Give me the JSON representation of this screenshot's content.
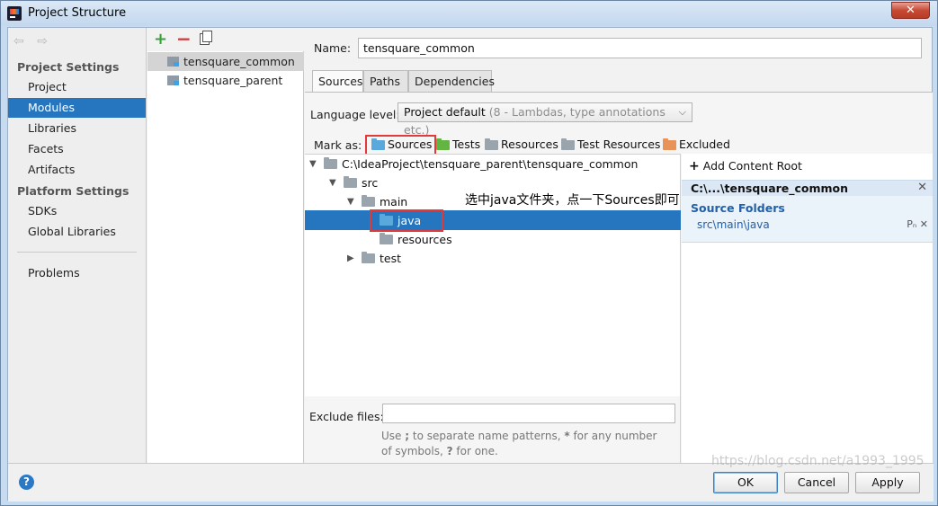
{
  "window": {
    "title": "Project Structure",
    "close_label": "✕"
  },
  "nav": {
    "back": "⇦",
    "forward": "⇨",
    "group1": "Project Settings",
    "items1": [
      "Project",
      "Modules",
      "Libraries",
      "Facets",
      "Artifacts"
    ],
    "group2": "Platform Settings",
    "items2": [
      "SDKs",
      "Global Libraries"
    ],
    "problems": "Problems",
    "active": "Modules"
  },
  "modules": {
    "add": "+",
    "remove": "−",
    "items": [
      "tensquare_common",
      "tensquare_parent"
    ],
    "selected": "tensquare_common"
  },
  "detail": {
    "name_label": "Name:",
    "name_value": "tensquare_common",
    "tabs": [
      "Sources",
      "Paths",
      "Dependencies"
    ],
    "active_tab": "Sources",
    "language_label": "Language level:",
    "language_value": "Project default",
    "language_hint": "(8 - Lambdas, type annotations etc.)",
    "mark_as_label": "Mark as:",
    "mark_buttons": [
      {
        "label": "Sources",
        "color": "#5aa9dc"
      },
      {
        "label": "Tests",
        "color": "#62b543"
      },
      {
        "label": "Resources",
        "color": "#9aa4ad"
      },
      {
        "label": "Test Resources",
        "color": "#9aa4ad"
      },
      {
        "label": "Excluded",
        "color": "#e8935a"
      }
    ],
    "tree": {
      "root": "C:\\IdeaProject\\tensquare_parent\\tensquare_common",
      "src": "src",
      "main": "main",
      "java": "java",
      "resources": "resources",
      "test": "test"
    },
    "annotation": "选中java文件夹，点一下Sources即可",
    "exclude_label": "Exclude files:",
    "exclude_value": "",
    "exclude_hint_pre": "Use ",
    "exclude_hint_semi": ";",
    "exclude_hint_mid": " to separate name patterns, ",
    "exclude_hint_star": "*",
    "exclude_hint_mid2": " for any number of symbols, ",
    "exclude_hint_q": "?",
    "exclude_hint_end": " for one.",
    "content_root": {
      "add_label": "Add Content Root",
      "title": "C:\\...\\tensquare_common",
      "source_folders_label": "Source Folders",
      "source_path": "src\\main\\java",
      "source_actions": "Pₙ ✕",
      "remove": "✕"
    }
  },
  "footer": {
    "help": "?",
    "ok": "OK",
    "cancel": "Cancel",
    "apply": "Apply",
    "watermark": "https://blog.csdn.net/a1993_1995"
  }
}
